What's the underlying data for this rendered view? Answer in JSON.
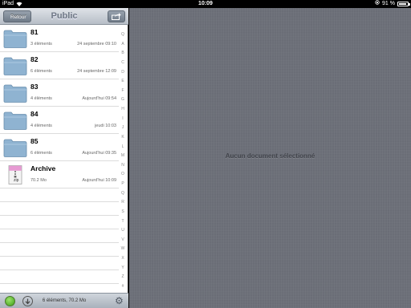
{
  "statusbar": {
    "device": "iPad",
    "time": "10:09",
    "battery_text": "91 %",
    "battery_level": 0.91
  },
  "navbar": {
    "back_label": "Retour",
    "title": "Public"
  },
  "files": [
    {
      "name": "81",
      "count": "3 éléments",
      "date": "24 septembre 09:10",
      "type": "folder"
    },
    {
      "name": "82",
      "count": "6 éléments",
      "date": "24 septembre 12:09",
      "type": "folder"
    },
    {
      "name": "83",
      "count": "4 éléments",
      "date": "Aujourd'hui 09:54",
      "type": "folder"
    },
    {
      "name": "84",
      "count": "4 éléments",
      "date": "jeudi 10:03",
      "type": "folder"
    },
    {
      "name": "85",
      "count": "6 éléments",
      "date": "Aujourd'hui 09:35",
      "type": "folder"
    },
    {
      "name": "Archive",
      "count": "70.2 Mo",
      "date": "Aujourd'hui 10:09",
      "type": "zip",
      "file_label": "zip"
    }
  ],
  "index_letters": [
    "Q",
    "A",
    "B",
    "C",
    "D",
    "E",
    "F",
    "G",
    "H",
    "I",
    "J",
    "K",
    "L",
    "M",
    "N",
    "O",
    "P",
    "Q",
    "R",
    "S",
    "T",
    "U",
    "V",
    "W",
    "X",
    "Y",
    "Z",
    "#"
  ],
  "toolbar": {
    "status": "6 éléments, 70.2 Mo"
  },
  "detail": {
    "message": "Aucun document sélectionné"
  },
  "colors": {
    "folder": "#8fb3d1",
    "pane": "#6d7079",
    "green": "#3c9e17"
  }
}
